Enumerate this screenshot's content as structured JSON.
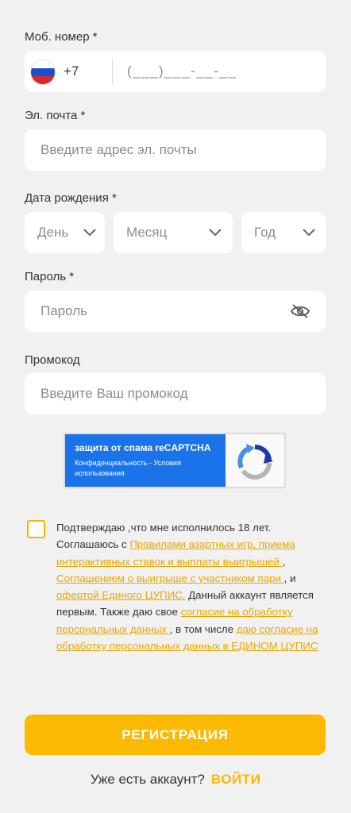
{
  "phone": {
    "label": "Моб. номер *",
    "country_code": "+7",
    "mask": "(___)___-__-__",
    "flag_icon": "russia-flag-icon"
  },
  "email": {
    "label": "Эл. почта *",
    "placeholder": "Введите адрес эл. почты"
  },
  "birthdate": {
    "label": "Дата рождения *",
    "day": "День",
    "month": "Месяц",
    "year": "Год"
  },
  "password": {
    "label": "Пароль *",
    "placeholder": "Пароль",
    "toggle_icon": "eye-off-icon"
  },
  "promo": {
    "label": "Промокод",
    "placeholder": "Введите Ваш промокод"
  },
  "recaptcha": {
    "title": "защита от спама reCAPTCHA",
    "links": "Конфиденциальность - Условия использования"
  },
  "consent": {
    "t1": "Подтверждаю ,что мне исполнилось 18 лет. Соглашаюсь с ",
    "link1": "Правилами азартных игр, приема интерактивных ставок и выплаты выигрышей ",
    "t2": ", ",
    "link2": "Соглашением о выигрыше с участником пари ",
    "t3": ", и ",
    "link3": "офертой Единого ЦУПИС.",
    "t4": " Данный аккаунт является первым. Также даю свое ",
    "link4": "согласие на обработку персональных данных ",
    "t5": ", в том числе ",
    "link5": "даю согласие на обработку персональных данных в ЕДИНОМ ЦУПИС"
  },
  "register_button": "РЕГИСТРАЦИЯ",
  "login": {
    "prompt": "Уже есть аккаунт?",
    "link": "ВОЙТИ"
  },
  "colors": {
    "accent": "#fbb900",
    "link": "#e6a700",
    "recaptcha_blue": "#1a73e8",
    "background": "#f1f1f1"
  }
}
